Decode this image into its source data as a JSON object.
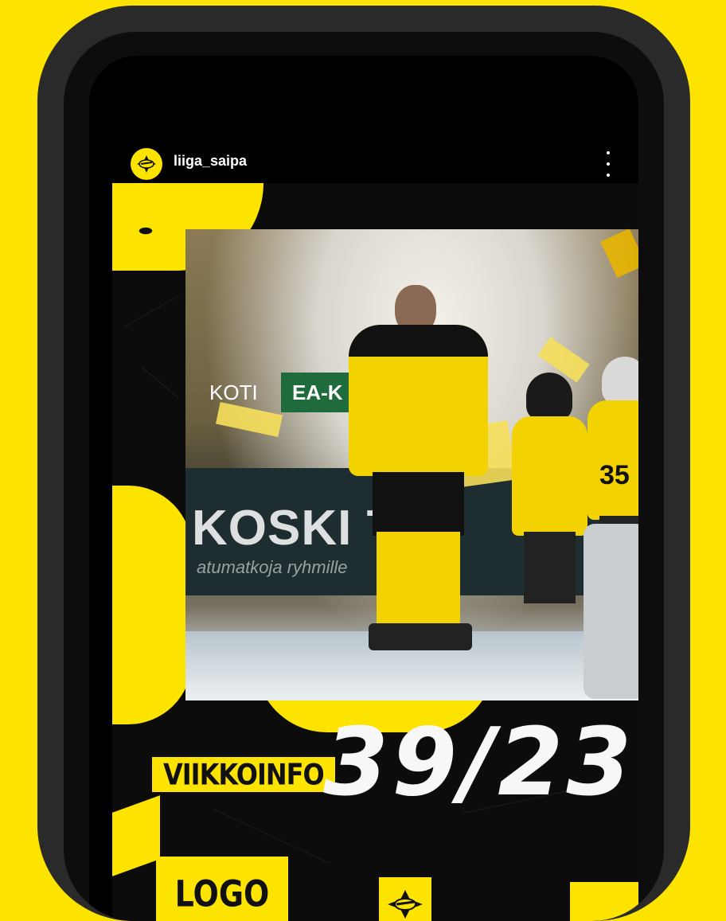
{
  "app": {
    "username": "liiga_saipa",
    "more_icon": "vertical-ellipsis-icon"
  },
  "post": {
    "board_text": "KOSKI TR",
    "board_subtext": "atumatkoja ryhmille",
    "green_sign": "EA-K",
    "koti_sign": "KOTI",
    "jersey_number": "35",
    "label_viikkoinfo": "VIIKKOINFO",
    "week": "39/23",
    "logo_placeholder": "LOGO"
  },
  "colors": {
    "brand_yellow": "#fde400",
    "background_black": "#0c0c0c",
    "phone_frame": "#2a2a2a"
  }
}
